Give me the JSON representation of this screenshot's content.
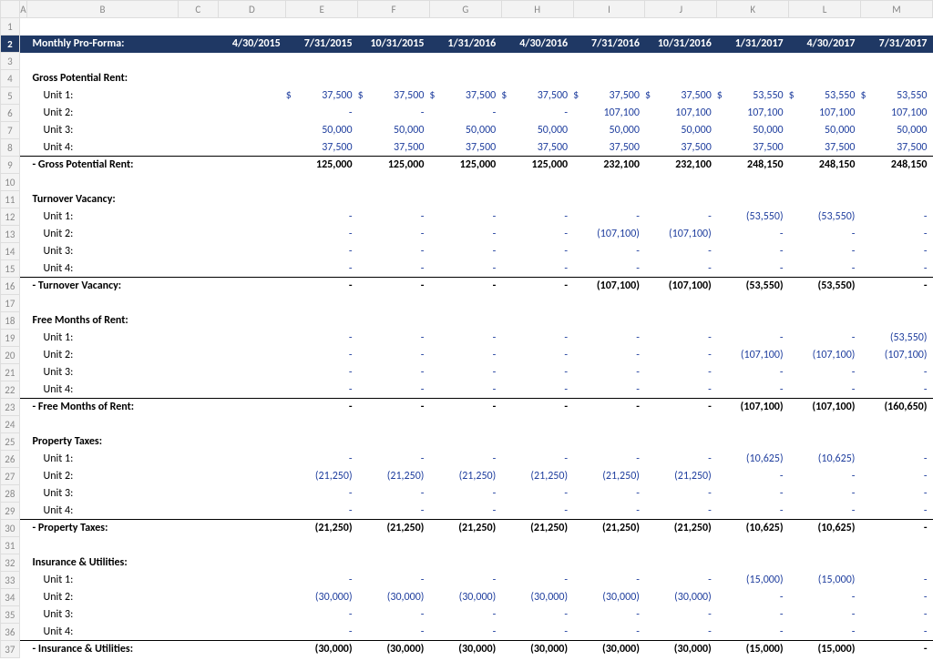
{
  "header": {
    "title": "Monthly Pro-Forma:",
    "dates": [
      "4/30/2015",
      "7/31/2015",
      "10/31/2015",
      "1/31/2016",
      "4/30/2016",
      "7/31/2016",
      "10/31/2016",
      "1/31/2017",
      "4/30/2017",
      "7/31/2017"
    ]
  },
  "sections": [
    {
      "title": "Gross Potential Rent:",
      "rows": [
        {
          "label": "Unit 1:",
          "dollar": true,
          "color": "blue",
          "vals": [
            "37,500",
            "37,500",
            "37,500",
            "37,500",
            "37,500",
            "37,500",
            "53,550",
            "53,550",
            "53,550"
          ]
        },
        {
          "label": "Unit 2:",
          "color": "blue",
          "vals": [
            "-",
            "-",
            "-",
            "-",
            "107,100",
            "107,100",
            "107,100",
            "107,100",
            "107,100"
          ]
        },
        {
          "label": "Unit 3:",
          "color": "blue",
          "vals": [
            "50,000",
            "50,000",
            "50,000",
            "50,000",
            "50,000",
            "50,000",
            "50,000",
            "50,000",
            "50,000"
          ]
        },
        {
          "label": "Unit 4:",
          "color": "blue",
          "underline": true,
          "vals": [
            "37,500",
            "37,500",
            "37,500",
            "37,500",
            "37,500",
            "37,500",
            "37,500",
            "37,500",
            "37,500"
          ]
        }
      ],
      "total": {
        "label": " - Gross Potential Rent:",
        "vals": [
          "125,000",
          "125,000",
          "125,000",
          "125,000",
          "232,100",
          "232,100",
          "248,150",
          "248,150",
          "248,150"
        ]
      }
    },
    {
      "title": "Turnover Vacancy:",
      "rows": [
        {
          "label": "Unit 1:",
          "color": "blue",
          "vals": [
            "-",
            "-",
            "-",
            "-",
            "-",
            "-",
            "(53,550)",
            "(53,550)",
            "-"
          ]
        },
        {
          "label": "Unit 2:",
          "color": "blue",
          "vals": [
            "-",
            "-",
            "-",
            "-",
            "(107,100)",
            "(107,100)",
            "-",
            "-",
            "-"
          ]
        },
        {
          "label": "Unit 3:",
          "color": "blue",
          "vals": [
            "-",
            "-",
            "-",
            "-",
            "-",
            "-",
            "-",
            "-",
            "-"
          ]
        },
        {
          "label": "Unit 4:",
          "color": "blue",
          "underline": true,
          "vals": [
            "-",
            "-",
            "-",
            "-",
            "-",
            "-",
            "-",
            "-",
            "-"
          ]
        }
      ],
      "total": {
        "label": " - Turnover Vacancy:",
        "vals": [
          "-",
          "-",
          "-",
          "-",
          "(107,100)",
          "(107,100)",
          "(53,550)",
          "(53,550)",
          "-"
        ]
      }
    },
    {
      "title": "Free Months of Rent:",
      "rows": [
        {
          "label": "Unit 1:",
          "color": "blue",
          "vals": [
            "-",
            "-",
            "-",
            "-",
            "-",
            "-",
            "-",
            "-",
            "(53,550)"
          ]
        },
        {
          "label": "Unit 2:",
          "color": "blue",
          "vals": [
            "-",
            "-",
            "-",
            "-",
            "-",
            "-",
            "(107,100)",
            "(107,100)",
            "(107,100)"
          ]
        },
        {
          "label": "Unit 3:",
          "color": "blue",
          "vals": [
            "-",
            "-",
            "-",
            "-",
            "-",
            "-",
            "-",
            "-",
            "-"
          ]
        },
        {
          "label": "Unit 4:",
          "color": "blue",
          "underline": true,
          "vals": [
            "-",
            "-",
            "-",
            "-",
            "-",
            "-",
            "-",
            "-",
            "-"
          ]
        }
      ],
      "total": {
        "label": " - Free Months of Rent:",
        "vals": [
          "-",
          "-",
          "-",
          "-",
          "-",
          "-",
          "(107,100)",
          "(107,100)",
          "(160,650)"
        ]
      }
    },
    {
      "title": "Property Taxes:",
      "rows": [
        {
          "label": "Unit 1:",
          "color": "blue",
          "vals": [
            "-",
            "-",
            "-",
            "-",
            "-",
            "-",
            "(10,625)",
            "(10,625)",
            "-"
          ]
        },
        {
          "label": "Unit 2:",
          "color": "blue",
          "vals": [
            "(21,250)",
            "(21,250)",
            "(21,250)",
            "(21,250)",
            "(21,250)",
            "(21,250)",
            "-",
            "-",
            "-"
          ]
        },
        {
          "label": "Unit 3:",
          "color": "blue",
          "vals": [
            "-",
            "-",
            "-",
            "-",
            "-",
            "-",
            "-",
            "-",
            "-"
          ]
        },
        {
          "label": "Unit 4:",
          "color": "blue",
          "underline": true,
          "vals": [
            "-",
            "-",
            "-",
            "-",
            "-",
            "-",
            "-",
            "-",
            "-"
          ]
        }
      ],
      "total": {
        "label": " - Property Taxes:",
        "vals": [
          "(21,250)",
          "(21,250)",
          "(21,250)",
          "(21,250)",
          "(21,250)",
          "(21,250)",
          "(10,625)",
          "(10,625)",
          "-"
        ]
      }
    },
    {
      "title": "Insurance & Utilities:",
      "rows": [
        {
          "label": "Unit 1:",
          "color": "blue",
          "vals": [
            "-",
            "-",
            "-",
            "-",
            "-",
            "-",
            "(15,000)",
            "(15,000)",
            "-"
          ]
        },
        {
          "label": "Unit 2:",
          "color": "blue",
          "vals": [
            "(30,000)",
            "(30,000)",
            "(30,000)",
            "(30,000)",
            "(30,000)",
            "(30,000)",
            "-",
            "-",
            "-"
          ]
        },
        {
          "label": "Unit 3:",
          "color": "blue",
          "vals": [
            "-",
            "-",
            "-",
            "-",
            "-",
            "-",
            "-",
            "-",
            "-"
          ]
        },
        {
          "label": "Unit 4:",
          "color": "blue",
          "underline": true,
          "vals": [
            "-",
            "-",
            "-",
            "-",
            "-",
            "-",
            "-",
            "-",
            "-"
          ]
        }
      ],
      "total": {
        "label": " - Insurance & Utilities:",
        "vals": [
          "(30,000)",
          "(30,000)",
          "(30,000)",
          "(30,000)",
          "(30,000)",
          "(30,000)",
          "(15,000)",
          "(15,000)",
          "-"
        ]
      }
    }
  ],
  "columns": [
    "A",
    "B",
    "C",
    "D",
    "E",
    "F",
    "G",
    "H",
    "I",
    "J",
    "K",
    "L",
    "M"
  ],
  "row_numbers": 37
}
